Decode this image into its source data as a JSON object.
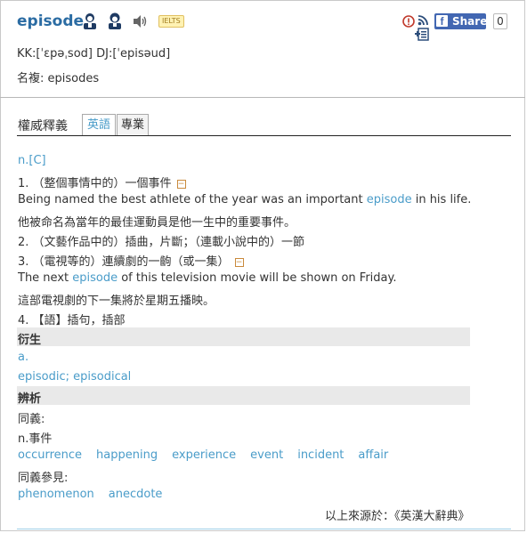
{
  "header": {
    "word": "episode",
    "ielts_badge": "IELTS",
    "pronunciation": "KK:[ˈɛpəˌsod] DJ:[ˈepisəud]",
    "plural": "名複: episodes",
    "share_label": "Share",
    "share_count": "0"
  },
  "tabs": {
    "title": "權威釋義",
    "items": [
      "英語",
      "專業"
    ],
    "active": "英語"
  },
  "definitions": {
    "pos": "n.[C]",
    "items": [
      {
        "num": "1. ",
        "text": "（整個事情中的）一個事件",
        "example_en_before": "Being named the best athlete of the year was an important ",
        "example_en_word": "episode",
        "example_en_after": " in his life.",
        "example_zh": "他被命名為當年的最佳運動員是他一生中的重要事件。"
      },
      {
        "num": "2. ",
        "text": "（文藝作品中的）插曲，片斷；（連載小說中的）一節"
      },
      {
        "num": "3. ",
        "text": "（電視等的）連續劇的一齣（或一集）",
        "example_en_before": "The next ",
        "example_en_word": "episode",
        "example_en_after": " of this television movie will be shown on Friday.",
        "example_zh": "這部電視劇的下一集將於星期五播映。"
      },
      {
        "num": "4. ",
        "text": "【語】插句，插部"
      }
    ]
  },
  "derivation": {
    "heading": "衍生",
    "pos": "a.",
    "words": "episodic; episodical"
  },
  "analysis": {
    "heading": "辨析",
    "synonyms_label": "同義:",
    "synonyms_pos": "n.事件",
    "synonyms": [
      "occurrence",
      "happening",
      "experience",
      "event",
      "incident",
      "affair"
    ],
    "see_also_label": "同義參見:",
    "see_also": [
      "phenomenon",
      "anecdote"
    ]
  },
  "source": "以上來源於：《英漢大辭典》",
  "colors": {
    "word": "#2b6ca3",
    "link": "#4a9cc9",
    "facebook": "#4267b2",
    "band": "#e9e9e9"
  },
  "icons": [
    "male-voice-icon",
    "female-voice-icon",
    "speaker-icon",
    "report-icon",
    "rss-icon",
    "add-to-list-icon",
    "facebook-icon",
    "collapse-icon"
  ]
}
